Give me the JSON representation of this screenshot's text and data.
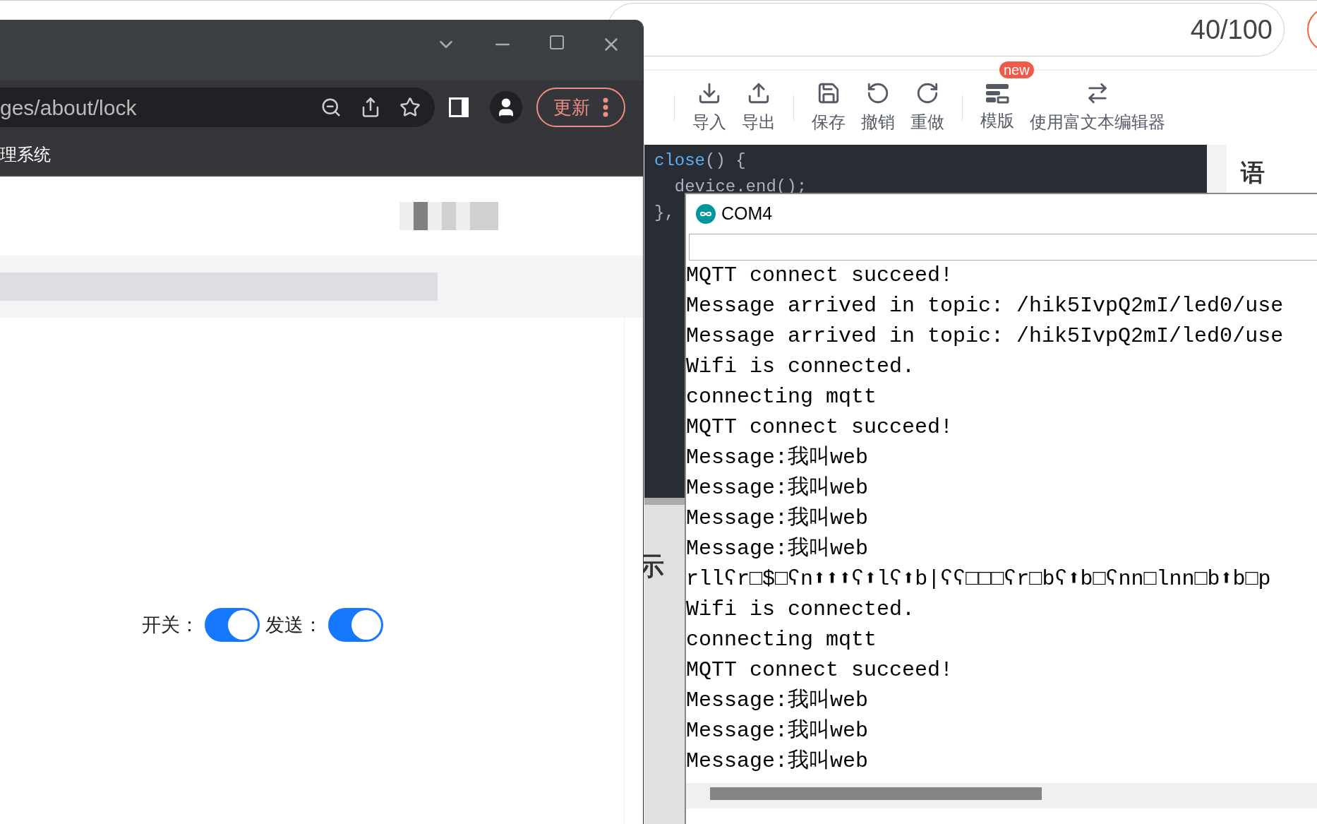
{
  "editor": {
    "char_count": "40/100",
    "toolbar": [
      {
        "kind": "import",
        "label": "导入"
      },
      {
        "kind": "export",
        "label": "导出"
      },
      {
        "kind": "save",
        "label": "保存"
      },
      {
        "kind": "undo",
        "label": "撤销"
      },
      {
        "kind": "redo",
        "label": "重做"
      },
      {
        "kind": "template",
        "label": "模版",
        "badge": "new"
      },
      {
        "kind": "switch",
        "label": "使用富文本编辑器"
      }
    ],
    "code": [
      {
        "kind": "call",
        "name": "close",
        "rest": "() {"
      },
      {
        "kind": "plain",
        "name": "  device.end();"
      },
      {
        "kind": "plain",
        "name": "},"
      }
    ],
    "side_heading": "语",
    "side_label": "示"
  },
  "browser": {
    "address": "ges/about/lock",
    "update_button": "更新",
    "bookmark": "理系统",
    "switches": [
      {
        "label": "开关：",
        "on": true
      },
      {
        "label": "发送：",
        "on": true
      }
    ]
  },
  "serial_monitor": {
    "title": "COM4",
    "lines": [
      "MQTT connect succeed!",
      "Message arrived in topic: /hik5IvpQ2mI/led0/use",
      "Message arrived in topic: /hik5IvpQ2mI/led0/use",
      "Wifi is connected.",
      "connecting mqtt",
      "MQTT connect succeed!",
      "Message:我叫web",
      "Message:我叫web",
      "Message:我叫web",
      "Message:我叫web",
      "rllʕr□$□ʕn⬆⬆⬆ʕ⬆lʕ⬆b|ʕʕ□□□ʕr□bʕ⬆b□ʕnn□lnn□b⬆b□p",
      "Wifi is connected.",
      "connecting mqtt",
      "MQTT connect succeed!",
      "Message:我叫web",
      "Message:我叫web",
      "Message:我叫web"
    ]
  }
}
